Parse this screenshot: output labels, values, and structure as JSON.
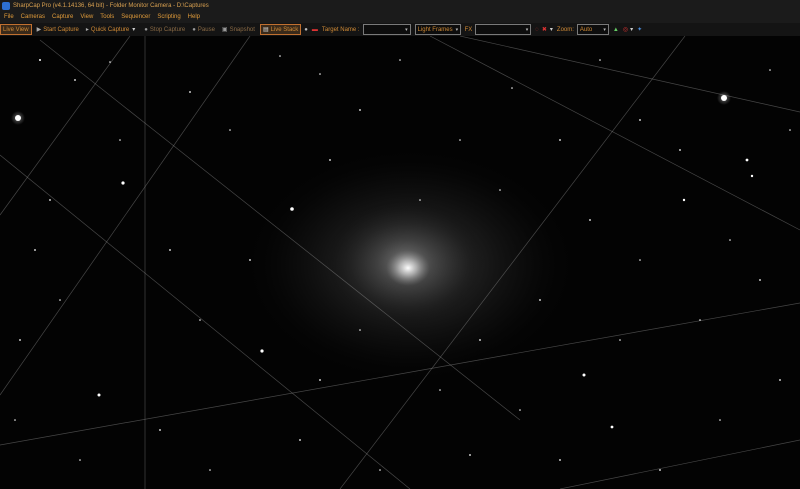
{
  "window": {
    "title": "SharpCap Pro (v4.1.14136, 64 bit) - Folder Monitor Camera - D:\\Captures"
  },
  "menu": [
    "File",
    "Cameras",
    "Capture",
    "View",
    "Tools",
    "Sequencer",
    "Scripting",
    "Help"
  ],
  "toolbar": {
    "live_view": "Live View",
    "start_capture": "Start Capture",
    "quick_capture": "Quick Capture",
    "stop_capture": "Stop Capture",
    "pause": "Pause",
    "snapshot": "Snapshot",
    "live_stack": "Live Stack",
    "target_name_label": "Target Name :",
    "target_name_value": "",
    "frame_type": "Light Frames",
    "fx_label": "FX",
    "fx_value": "",
    "zoom_label": "Zoom:",
    "zoom_value": "Auto"
  },
  "icons": [
    "app-icon",
    "start-capture-icon",
    "quick-capture-icon",
    "stop-capture-icon",
    "pause-icon",
    "snapshot-icon",
    "live-stack-icon",
    "sphere-icon",
    "film-icon",
    "crosshair-icon",
    "grid-icon",
    "histogram-icon",
    "target-icon",
    "satellite-icon"
  ],
  "colors": {
    "menu_text": "#e09b3a",
    "toolbar_bg": "#141414",
    "sky": "#000000"
  }
}
